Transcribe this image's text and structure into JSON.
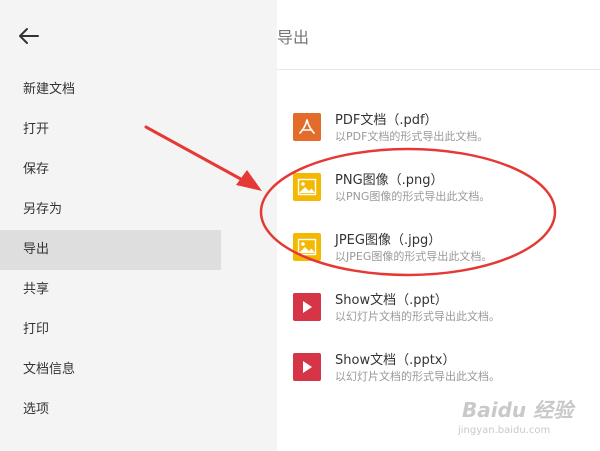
{
  "sidebar": {
    "back_icon": "arrow-left-icon",
    "items": [
      {
        "label": "新建文档"
      },
      {
        "label": "打开"
      },
      {
        "label": "保存"
      },
      {
        "label": "另存为"
      },
      {
        "label": "导出",
        "active": true
      },
      {
        "label": "共享"
      },
      {
        "label": "打印"
      },
      {
        "label": "文档信息"
      },
      {
        "label": "选项"
      }
    ]
  },
  "main": {
    "title": "导出",
    "items": [
      {
        "name": "PDF文档（.pdf）",
        "desc": "以PDF文档的形式导出此文档。",
        "icon": "pdf-icon",
        "color": "#e46c2a"
      },
      {
        "name": "PNG图像（.png）",
        "desc": "以PNG图像的形式导出此文档。",
        "icon": "image-icon",
        "color": "#f5b800"
      },
      {
        "name": "JPEG图像（.jpg）",
        "desc": "以JPEG图像的形式导出此文档。",
        "icon": "image-icon",
        "color": "#f5b800"
      },
      {
        "name": "Show文档（.ppt）",
        "desc": "以幻灯片文档的形式导出此文档。",
        "icon": "show-icon",
        "color": "#d63547"
      },
      {
        "name": "Show文档（.pptx）",
        "desc": "以幻灯片文档的形式导出此文档。",
        "icon": "show-icon",
        "color": "#d63547"
      }
    ]
  },
  "annotation": {
    "color": "#e53935"
  },
  "watermark": {
    "logo": "Baidu 经验",
    "url": "jingyan.baidu.com"
  }
}
